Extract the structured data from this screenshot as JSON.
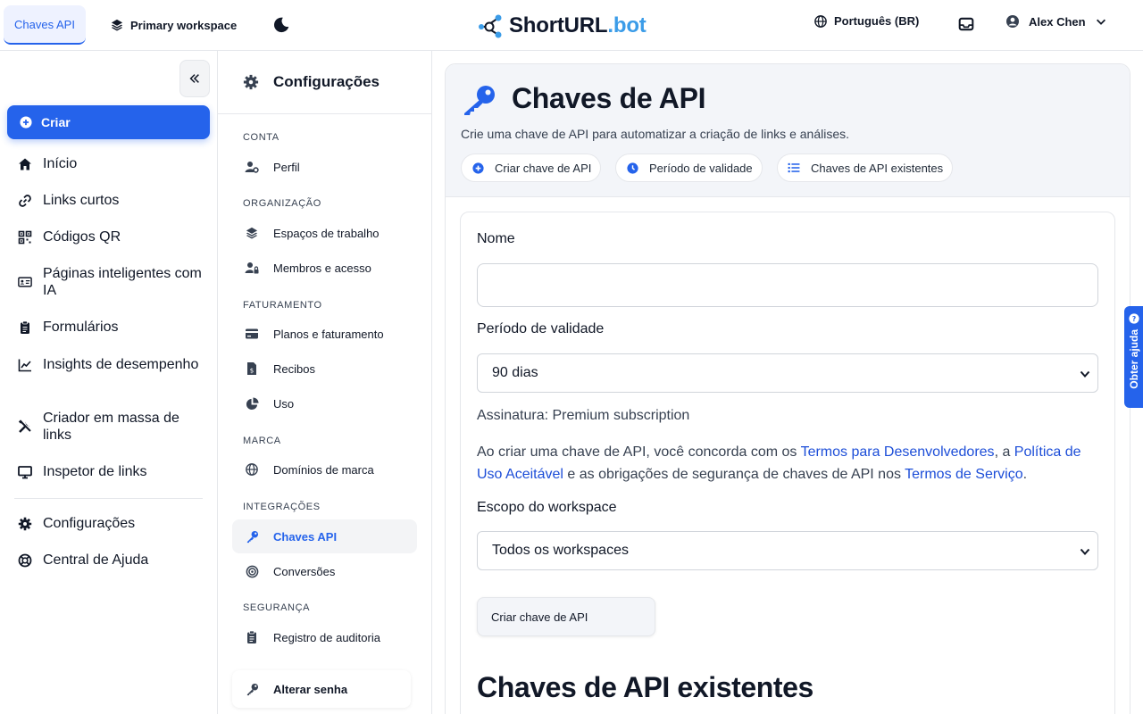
{
  "topbar": {
    "active_tab": "Chaves API",
    "workspace": "Primary workspace",
    "logo_main": "ShortURL",
    "logo_suffix": ".bot",
    "language": "Português (BR)",
    "user_name": "Alex Chen"
  },
  "sidebar": {
    "create_label": "Criar",
    "items": [
      {
        "label": "Início",
        "icon": "home-icon"
      },
      {
        "label": "Links curtos",
        "icon": "link-icon"
      },
      {
        "label": "Códigos QR",
        "icon": "qr-icon"
      },
      {
        "label": "Páginas inteligentes com IA",
        "icon": "id-card-icon"
      },
      {
        "label": "Formulários",
        "icon": "clipboard-icon"
      },
      {
        "label": "Insights de desempenho",
        "icon": "chart-line-icon"
      },
      {
        "label": "Criador em massa de links",
        "icon": "tools-icon"
      },
      {
        "label": "Inspetor de links",
        "icon": "monitor-icon"
      },
      {
        "label": "Configurações",
        "icon": "gear-icon"
      },
      {
        "label": "Central de Ajuda",
        "icon": "lifebuoy-icon"
      }
    ]
  },
  "settings": {
    "title": "Configurações",
    "sections": {
      "conta": "CONTA",
      "organizacao": "ORGANIZAÇÃO",
      "faturamento": "FATURAMENTO",
      "marca": "MARCA",
      "integracoes": "INTEGRAÇÕES",
      "seguranca": "SEGURANÇA"
    },
    "items": {
      "perfil": "Perfil",
      "espacos": "Espaços de trabalho",
      "membros": "Membros e acesso",
      "planos": "Planos e faturamento",
      "recibos": "Recibos",
      "uso": "Uso",
      "dominios": "Domínios de marca",
      "chaves": "Chaves API",
      "conversoes": "Conversões",
      "auditoria": "Registro de auditoria",
      "senha": "Alterar senha"
    }
  },
  "main": {
    "title": "Chaves de API",
    "subtitle": "Crie uma chave de API para automatizar a criação de links e análises.",
    "pills": {
      "create": "Criar chave de API",
      "validity": "Período de validade",
      "existing": "Chaves de API existentes"
    },
    "form": {
      "name_label": "Nome",
      "name_value": "",
      "validity_label": "Período de validade",
      "validity_value": "90 dias",
      "signature": "Assinatura: Premium subscription",
      "terms_prefix": "Ao criar uma chave de API, você concorda com os ",
      "terms_link1": "Termos para Desenvolvedores",
      "terms_mid1": ", a ",
      "terms_link2": "Política de Uso Aceitável",
      "terms_mid2": " e as obrigações de segurança de chaves de API nos ",
      "terms_link3": "Termos de Serviço",
      "terms_suffix": ".",
      "scope_label": "Escopo do workspace",
      "scope_value": "Todos os workspaces",
      "submit_label": "Criar chave de API"
    },
    "existing_title": "Chaves de API existentes"
  },
  "help_tab": "Obter ajuda",
  "colors": {
    "accent": "#2563eb",
    "link": "#1d4ed8",
    "header_bg": "#f3f5f9"
  }
}
